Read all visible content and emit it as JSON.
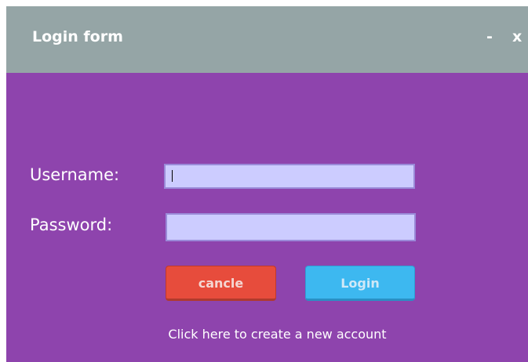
{
  "window": {
    "title": "Login form",
    "minimize_label": "-",
    "close_label": "x"
  },
  "form": {
    "username_label": "Username:",
    "username_value": "",
    "password_label": "Password:",
    "password_value": "",
    "cancel_label": "cancle",
    "login_label": "Login",
    "create_account_link": "Click here to create a new account"
  },
  "colors": {
    "titlebar": "#95a5a6",
    "panel": "#8e44ad",
    "input_bg": "#ccccff",
    "cancel_button": "#e74c3c",
    "login_button": "#3db8f0"
  }
}
